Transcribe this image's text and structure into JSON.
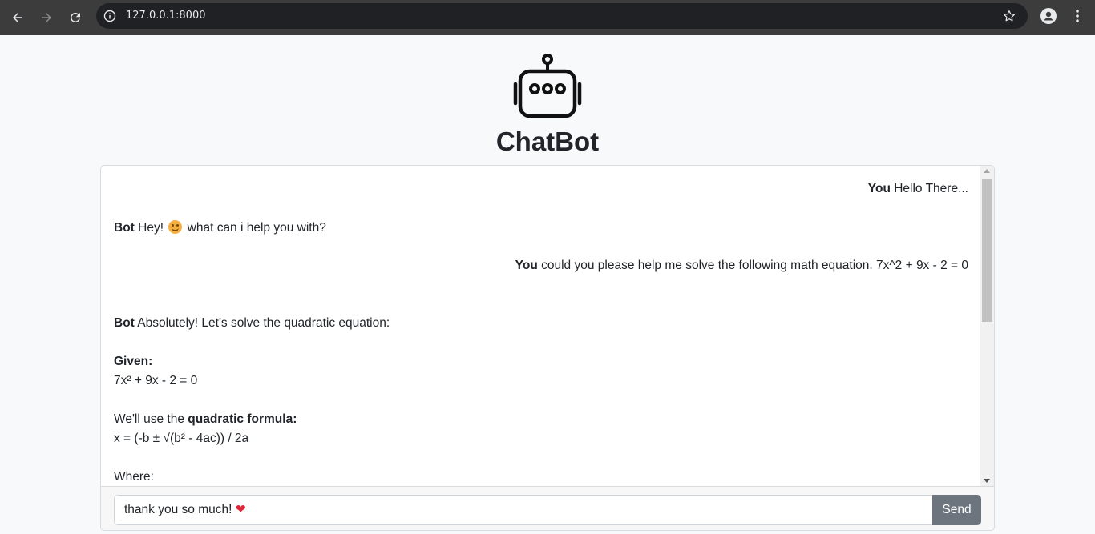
{
  "browser": {
    "url": "127.0.0.1:8000"
  },
  "page": {
    "title": "ChatBot"
  },
  "chat": {
    "messages": [
      {
        "sender": "You",
        "text": "Hello There..."
      },
      {
        "sender": "Bot",
        "text_before_emoji": "Hey!",
        "text_after_emoji": "what can i help you with?"
      },
      {
        "sender": "You",
        "text": "could you please help me solve the following math equation. 7x^2 + 9x - 2 = 0"
      },
      {
        "sender": "Bot",
        "text": "Absolutely! Let's solve the quadratic equation:"
      }
    ],
    "bot_detail": {
      "given_label": "Given:",
      "equation": "7x² + 9x - 2 = 0",
      "formula_intro": "We'll use the",
      "formula_name": "quadratic formula:",
      "formula": "x = (-b ± √(b² - 4ac)) / 2a",
      "where_label": "Where:"
    }
  },
  "input": {
    "value": "thank you so much!",
    "emoji": "❤"
  },
  "send_button": {
    "label": "Send"
  },
  "colors": {
    "send_bg": "#6c757d",
    "page_bg": "#f8f9fa",
    "browser_bar": "#3c3c3c"
  }
}
